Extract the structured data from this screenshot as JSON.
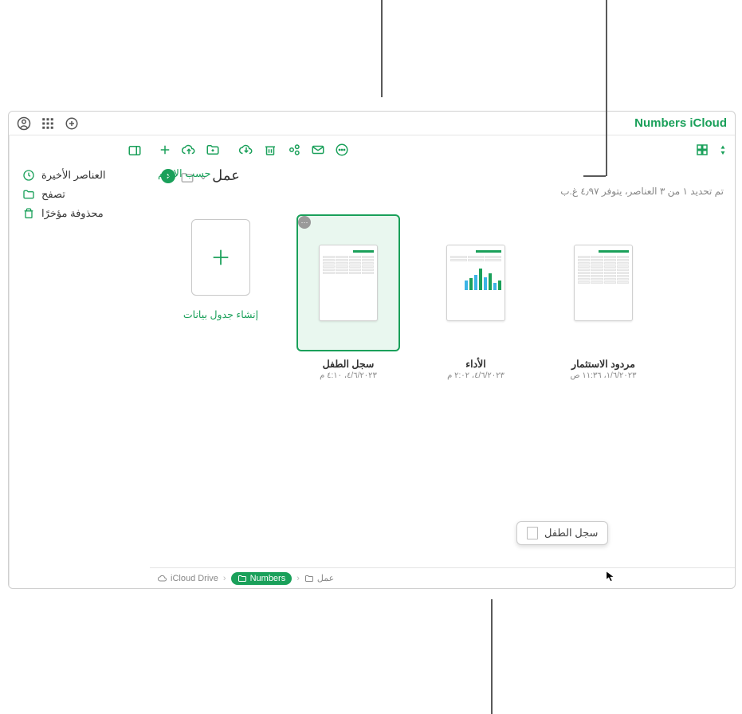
{
  "app": {
    "title": "Numbers  iCloud"
  },
  "sidebar": {
    "recent": "العناصر الأخيرة",
    "browse": "تصفح",
    "deleted": "محذوفة مؤخرًا"
  },
  "header": {
    "folder_name": "عمل",
    "status": "تم تحديد ١ من ٣ العناصر، يتوفر ٤٫٩٧ غ.ب"
  },
  "sort_label": "حسب الاسم",
  "new_tile_label": "إنشاء جدول بيانات",
  "items": [
    {
      "title": "سجل الطفل",
      "date": "٤/٦/٢٠٢٣، ٤:١٠ م"
    },
    {
      "title": "الأداء",
      "date": "٤/٦/٢٠٢٣، ٢:٠٢ م"
    },
    {
      "title": "مردود الاستثمار",
      "date": "١/٦/٢٠٢٣، ١١:٣٦ ص"
    }
  ],
  "drag_label": "سجل الطفل",
  "breadcrumb": {
    "root": "iCloud Drive",
    "mid": "Numbers",
    "leaf": "عمل"
  },
  "colors": {
    "accent": "#1aa05a"
  }
}
